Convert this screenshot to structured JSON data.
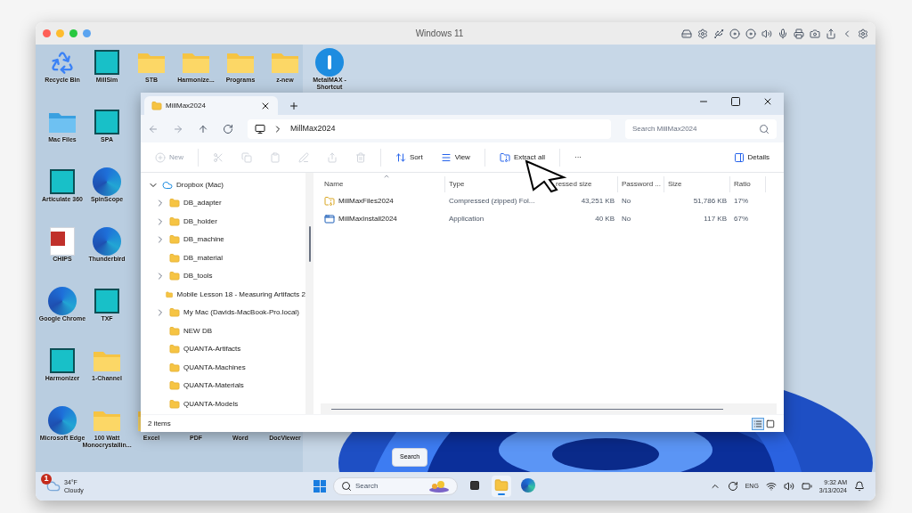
{
  "host_window": {
    "title": "Windows 11"
  },
  "desktop": {
    "rows": [
      [
        {
          "label": "Recycle Bin",
          "kind": "bin"
        },
        {
          "label": "MillSim",
          "kind": "app"
        },
        {
          "label": "STB",
          "kind": "folder"
        },
        {
          "label": "Harmonize...",
          "kind": "folder"
        },
        {
          "label": "Programs",
          "kind": "folder"
        },
        {
          "label": "z-new",
          "kind": "folder"
        },
        {
          "label": "MetalMAX - Shortcut",
          "kind": "info"
        }
      ],
      [
        {
          "label": "Mac Files",
          "kind": "macfolder"
        },
        {
          "label": "SPA",
          "kind": "app"
        }
      ],
      [
        {
          "label": "Articulate 360",
          "kind": "app"
        },
        {
          "label": "SpinScope",
          "kind": "globe"
        }
      ],
      [
        {
          "label": "CHIPS",
          "kind": "doc"
        },
        {
          "label": "Thunderbird",
          "kind": "globe"
        }
      ],
      [
        {
          "label": "Google Chrome",
          "kind": "globe"
        },
        {
          "label": "TXF",
          "kind": "app"
        }
      ],
      [
        {
          "label": "Harmonizer",
          "kind": "app"
        },
        {
          "label": "1-Channel",
          "kind": "folder"
        }
      ],
      [
        {
          "label": "Microsoft Edge",
          "kind": "globe"
        },
        {
          "label": "100 Watt Monocrystallin...",
          "kind": "folder"
        },
        {
          "label": "Excel",
          "kind": "folder"
        },
        {
          "label": "PDF",
          "kind": "covered"
        },
        {
          "label": "Word",
          "kind": "covered"
        },
        {
          "label": "DocViewer",
          "kind": "covered"
        }
      ]
    ]
  },
  "explorer": {
    "tab": {
      "title": "MillMax2024"
    },
    "address": {
      "path": "MillMax2024"
    },
    "search": {
      "placeholder": "Search MillMax2024"
    },
    "toolbar": [
      {
        "label": "New",
        "disabled": true
      },
      {
        "disabled": true
      },
      {
        "disabled": true
      },
      {
        "disabled": true
      },
      {
        "disabled": true
      },
      {
        "disabled": true
      },
      {
        "disabled": true
      },
      {
        "label": "Sort",
        "disabled": false
      },
      {
        "label": "View",
        "disabled": false
      },
      {
        "label": "Extract all",
        "disabled": false
      },
      {
        "label": "···",
        "disabled": false
      }
    ],
    "details_button": "Details",
    "nav": [
      {
        "label": "Dropbox (Mac)",
        "expanded": true,
        "children": [
          {
            "label": "DB_adapter",
            "expandable": true
          },
          {
            "label": "DB_holder",
            "expandable": true
          },
          {
            "label": "DB_machine",
            "expandable": true
          },
          {
            "label": "DB_material",
            "expandable": false
          },
          {
            "label": "DB_tools",
            "expandable": true
          },
          {
            "label": "Mobile Lesson 18 - Measuring Artifacts 2",
            "expandable": false
          },
          {
            "label": "My Mac (Davids-MacBook-Pro.local)",
            "expandable": true
          },
          {
            "label": "NEW DB",
            "expandable": false
          },
          {
            "label": "QUANTA-Artifacts",
            "expandable": false
          },
          {
            "label": "QUANTA-Machines",
            "expandable": false
          },
          {
            "label": "QUANTA-Materials",
            "expandable": false
          },
          {
            "label": "QUANTA-Models",
            "expandable": false
          }
        ]
      }
    ],
    "columns": [
      "Name",
      "Type",
      "ressed size",
      "Password ...",
      "Size",
      "Ratio"
    ],
    "rows": [
      {
        "kind": "zip",
        "cells": [
          "MillMaxFiles2024",
          "Compressed (zipped) Fol...",
          "43,251 KB",
          "No",
          "51,786 KB",
          "17%"
        ]
      },
      {
        "kind": "exe",
        "cells": [
          "MillMaxInstall2024",
          "Application",
          "40 KB",
          "No",
          "117 KB",
          "67%"
        ]
      }
    ],
    "status": "2 items",
    "views": [
      {
        "kind": "details",
        "selected": true
      },
      {
        "kind": "tiles",
        "selected": false
      }
    ]
  },
  "tooltip": "Search",
  "taskbar": {
    "weather": {
      "badge": "1",
      "temp": "34°F",
      "condition": "Cloudy"
    },
    "search_placeholder": "Search",
    "apps": [
      {
        "kind": "taskview",
        "selected": false
      },
      {
        "kind": "explorer",
        "selected": true
      },
      {
        "kind": "edge",
        "selected": false
      }
    ],
    "language": "ENG",
    "time": "9:32 AM",
    "date": "3/13/2024"
  }
}
